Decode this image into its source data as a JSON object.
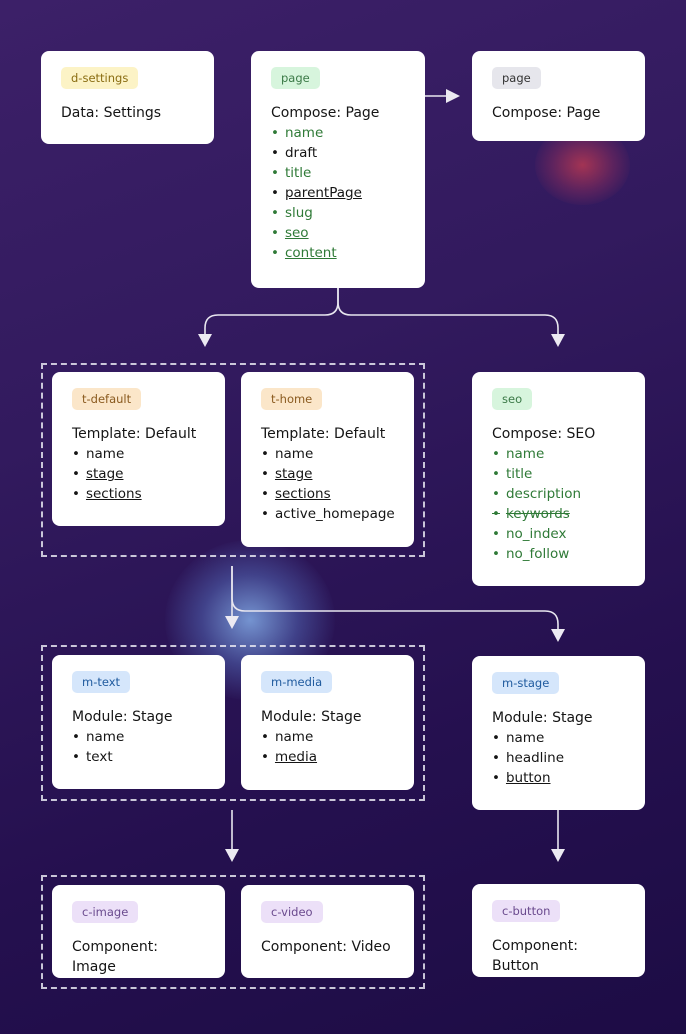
{
  "colors": {
    "background": "#2e1858",
    "card": "#ffffff",
    "field_active": "#2f7a37",
    "connector": "#e8e6ef"
  },
  "nodes": {
    "d_settings": {
      "tag": "d-settings",
      "title": "Data: Settings",
      "fields": []
    },
    "page": {
      "tag": "page",
      "title": "Compose: Page",
      "fields": [
        {
          "label": "name",
          "style": "green"
        },
        {
          "label": "draft",
          "style": "plain"
        },
        {
          "label": "title",
          "style": "green"
        },
        {
          "label": "parentPage",
          "style": "underline"
        },
        {
          "label": "slug",
          "style": "green"
        },
        {
          "label": "seo",
          "style": "green-underline"
        },
        {
          "label": "content",
          "style": "green-underline"
        }
      ]
    },
    "page_ref": {
      "tag": "page",
      "title": "Compose: Page",
      "fields": []
    },
    "t_default": {
      "tag": "t-default",
      "title": "Template: Default",
      "fields": [
        {
          "label": "name",
          "style": "plain"
        },
        {
          "label": "stage",
          "style": "underline"
        },
        {
          "label": "sections",
          "style": "underline"
        }
      ]
    },
    "t_home": {
      "tag": "t-home",
      "title": "Template: Default",
      "fields": [
        {
          "label": "name",
          "style": "plain"
        },
        {
          "label": "stage",
          "style": "underline"
        },
        {
          "label": "sections",
          "style": "underline"
        },
        {
          "label": "active_homepage",
          "style": "plain"
        }
      ]
    },
    "seo": {
      "tag": "seo",
      "title": "Compose: SEO",
      "fields": [
        {
          "label": "name",
          "style": "green"
        },
        {
          "label": "title",
          "style": "green"
        },
        {
          "label": "description",
          "style": "green"
        },
        {
          "label": "keywords",
          "style": "green-strike"
        },
        {
          "label": "no_index",
          "style": "green"
        },
        {
          "label": "no_follow",
          "style": "green"
        }
      ]
    },
    "m_text": {
      "tag": "m-text",
      "title": "Module: Stage",
      "fields": [
        {
          "label": "name",
          "style": "plain"
        },
        {
          "label": "text",
          "style": "plain"
        }
      ]
    },
    "m_media": {
      "tag": "m-media",
      "title": "Module: Stage",
      "fields": [
        {
          "label": "name",
          "style": "plain"
        },
        {
          "label": "media",
          "style": "underline"
        }
      ]
    },
    "m_stage": {
      "tag": "m-stage",
      "title": "Module: Stage",
      "fields": [
        {
          "label": "name",
          "style": "plain"
        },
        {
          "label": "headline",
          "style": "plain"
        },
        {
          "label": "button",
          "style": "underline"
        }
      ]
    },
    "c_image": {
      "tag": "c-image",
      "title": "Component: Image",
      "fields": []
    },
    "c_video": {
      "tag": "c-video",
      "title": "Component: Video",
      "fields": []
    },
    "c_button": {
      "tag": "c-button",
      "title": "Component: Button",
      "fields": []
    }
  },
  "edges": [
    {
      "from": "page",
      "to": "page_ref"
    },
    {
      "from": "page",
      "to": "templates-group"
    },
    {
      "from": "page",
      "to": "seo"
    },
    {
      "from": "templates-group",
      "to": "modules-group"
    },
    {
      "from": "templates-group",
      "to": "m_stage"
    },
    {
      "from": "modules-group",
      "to": "components-group"
    },
    {
      "from": "m_stage",
      "to": "c_button"
    }
  ]
}
